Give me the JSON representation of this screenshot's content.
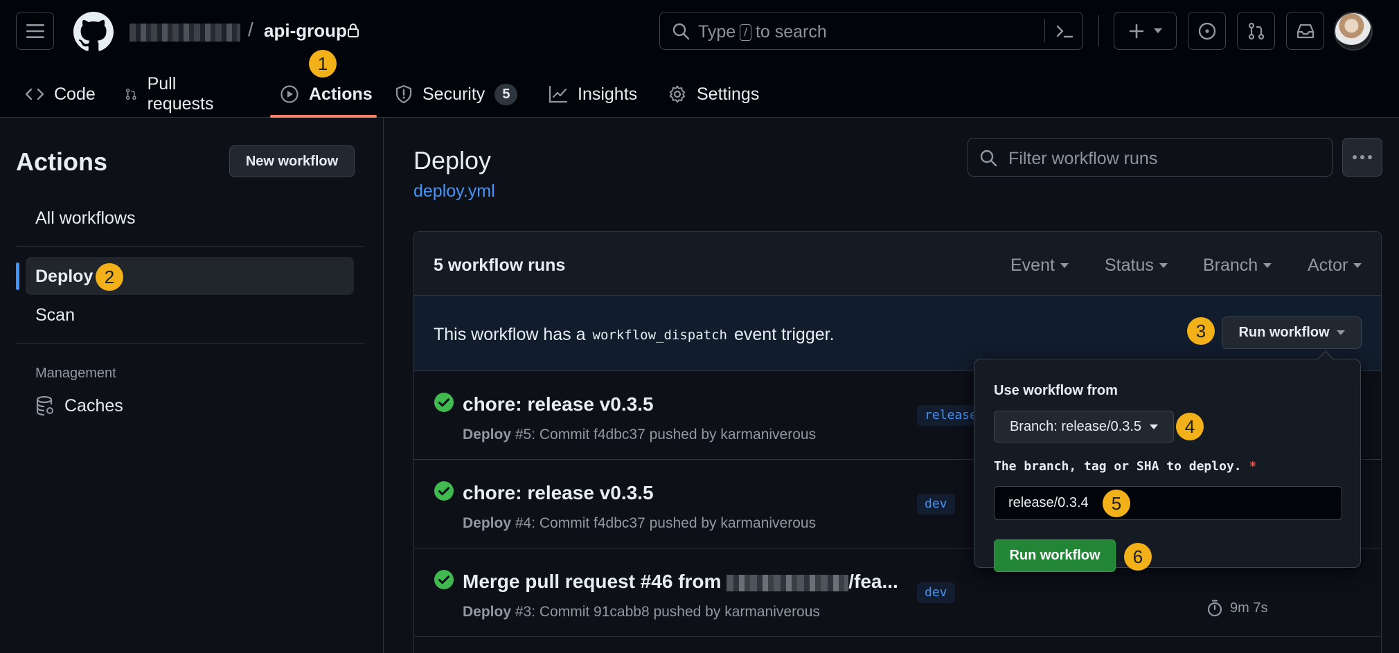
{
  "header": {
    "repo_name": "api-group",
    "search_placeholder_prefix": "Type",
    "search_key": "/",
    "search_placeholder_suffix": "to search"
  },
  "tabs": [
    {
      "label": "Code",
      "icon": "code-icon"
    },
    {
      "label": "Pull requests",
      "icon": "git-pull-request-icon"
    },
    {
      "label": "Actions",
      "icon": "play-icon",
      "active": true
    },
    {
      "label": "Security",
      "icon": "shield-icon",
      "counter": "5"
    },
    {
      "label": "Insights",
      "icon": "graph-icon"
    },
    {
      "label": "Settings",
      "icon": "gear-icon"
    }
  ],
  "sidebar": {
    "title": "Actions",
    "new_workflow": "New workflow",
    "all_workflows": "All workflows",
    "workflows": [
      "Deploy",
      "Scan"
    ],
    "section_label": "Management",
    "caches": "Caches"
  },
  "main": {
    "title": "Deploy",
    "file_link": "deploy.yml",
    "filter_placeholder": "Filter workflow runs",
    "runs_count": "5 workflow runs",
    "filters": [
      "Event",
      "Status",
      "Branch",
      "Actor"
    ],
    "dispatch_prefix": "This workflow has a",
    "dispatch_code": "workflow_dispatch",
    "dispatch_suffix": "event trigger.",
    "run_workflow_button": "Run workflow"
  },
  "runs": [
    {
      "title": "chore: release v0.3.5",
      "workflow": "Deploy",
      "detail": " #5: Commit f4dbc37 pushed by karmaniverous",
      "branch": "release"
    },
    {
      "title": "chore: release v0.3.5",
      "workflow": "Deploy",
      "detail": " #4: Commit f4dbc37 pushed by karmaniverous",
      "branch": "dev"
    },
    {
      "title_prefix": "Merge pull request #46 from ",
      "title_suffix": "/fea...",
      "workflow": "Deploy",
      "detail": " #3: Commit 91cabb8 pushed by karmaniverous",
      "branch": "dev",
      "duration": "9m 7s"
    }
  ],
  "popover": {
    "heading": "Use workflow from",
    "branch_button": "Branch: release/0.3.5",
    "input_label": "The branch, tag or SHA to deploy.",
    "required_mark": "*",
    "input_value": "release/0.3.4",
    "submit": "Run workflow"
  },
  "annotations": [
    "1",
    "2",
    "3",
    "4",
    "5",
    "6"
  ],
  "colors": {
    "accent_blue": "#4493f8",
    "tab_underline": "#f78166",
    "success": "#3fb950",
    "primary_button": "#238636",
    "annotation_badge": "#f2b019"
  }
}
